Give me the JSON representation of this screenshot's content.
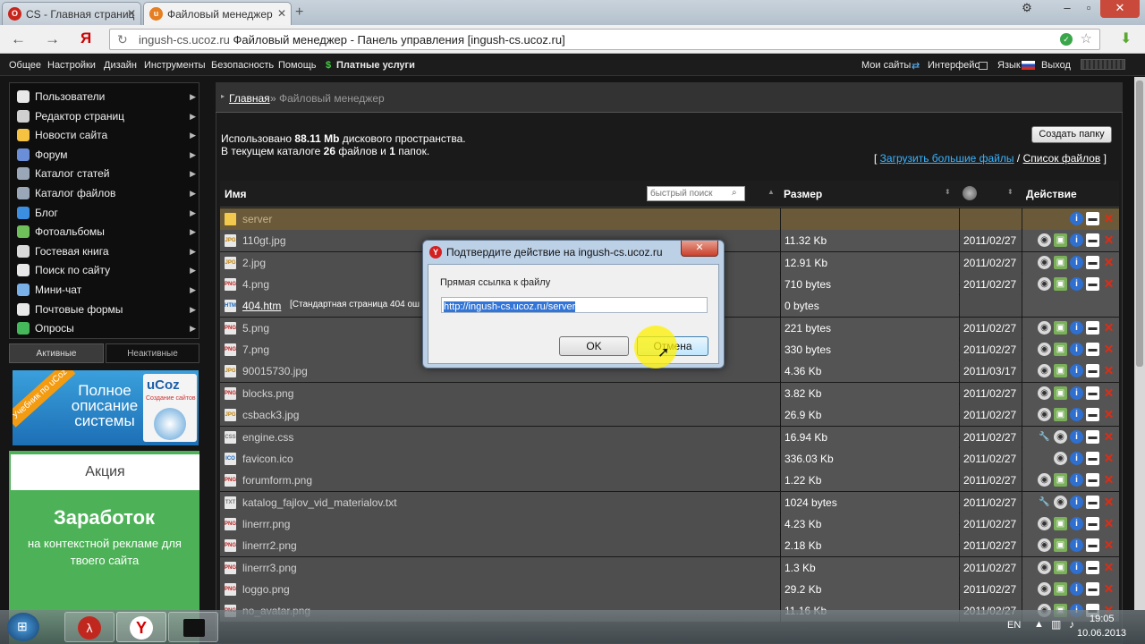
{
  "browser": {
    "tabs": [
      {
        "label": "CS - Главная страниц",
        "icon": "opera-icon",
        "active": false
      },
      {
        "label": "Файловый менеджер",
        "icon": "ucoz-icon",
        "active": true
      }
    ],
    "url_host": "ingush-cs.ucoz.ru",
    "url_title": "Файловый менеджер - Панель управления [ingush-cs.ucoz.ru]",
    "yandex_label": "Я"
  },
  "topmenu": {
    "left": [
      "Общее",
      "Настройки",
      "Дизайн",
      "Инструменты",
      "Безопасность",
      "Помощь",
      "Платные услуги"
    ],
    "right": [
      "Мои сайты",
      "Интерфейс",
      "Язык",
      "Выход"
    ]
  },
  "sidebar": {
    "items": [
      "Пользователи",
      "Редактор страниц",
      "Новости сайта",
      "Форум",
      "Каталог статей",
      "Каталог файлов",
      "Блог",
      "Фотоальбомы",
      "Гостевая книга",
      "Поиск по сайту",
      "Мини-чат",
      "Почтовые формы",
      "Опросы"
    ],
    "tab_active": "Активные",
    "tab_inactive": "Неактивные",
    "banner_ribbon": "Учебник по uCoz",
    "banner_text": "Полное описание системы",
    "banner_logo": "uCoz",
    "banner_sub": "Создание сайтов",
    "promo_title": "Акция",
    "promo_heading": "Заработок",
    "promo_text": "на контекстной рекламе для твоего сайта"
  },
  "breadcrumb": {
    "home": "Главная",
    "sep": "»",
    "current": "Файловый менеджер"
  },
  "info": {
    "used_prefix": "Использовано",
    "used_value": "88.11 Mb",
    "used_suffix": "дискового пространства.",
    "count_prefix": "В текущем каталоге",
    "files": "26",
    "files_word": "файлов и",
    "folders": "1",
    "folders_word": "папок.",
    "create_folder": "Создать папку",
    "upload_big": "Загрузить большие файлы",
    "file_list": "Список файлов"
  },
  "table": {
    "col_name": "Имя",
    "search_placeholder": "быстрый поиск",
    "col_size": "Размер",
    "col_action": "Действие",
    "rows": [
      {
        "name": "server",
        "type": "folder",
        "size": "",
        "date": "",
        "actions": [
          "info",
          "move",
          "delete"
        ]
      },
      {
        "name": "110gt.jpg",
        "type": "JPG",
        "size": "11.32 Kb",
        "date": "2011/02/27",
        "actions": [
          "view",
          "image",
          "info",
          "move",
          "delete"
        ]
      },
      {
        "name": "2.jpg",
        "type": "JPG",
        "size": "12.91 Kb",
        "date": "2011/02/27",
        "actions": [
          "view",
          "image",
          "info",
          "move",
          "delete"
        ]
      },
      {
        "name": "4.png",
        "type": "PNG",
        "size": "710 bytes",
        "date": "2011/02/27",
        "actions": [
          "view",
          "image",
          "info",
          "move",
          "delete"
        ]
      },
      {
        "name": "404.htm",
        "note": "[Стандартная страница 404 ош",
        "type": "HTM",
        "size": "0 bytes",
        "date": "",
        "actions": []
      },
      {
        "name": "5.png",
        "type": "PNG",
        "size": "221 bytes",
        "date": "2011/02/27",
        "actions": [
          "view",
          "image",
          "info",
          "move",
          "delete"
        ]
      },
      {
        "name": "7.png",
        "type": "PNG",
        "size": "330 bytes",
        "date": "2011/02/27",
        "actions": [
          "view",
          "image",
          "info",
          "move",
          "delete"
        ]
      },
      {
        "name": "90015730.jpg",
        "type": "JPG",
        "size": "4.36 Kb",
        "date": "2011/03/17",
        "actions": [
          "view",
          "image",
          "info",
          "move",
          "delete"
        ]
      },
      {
        "name": "blocks.png",
        "type": "PNG",
        "size": "3.82 Kb",
        "date": "2011/02/27",
        "actions": [
          "view",
          "image",
          "info",
          "move",
          "delete"
        ]
      },
      {
        "name": "csback3.jpg",
        "type": "JPG",
        "size": "26.9 Kb",
        "date": "2011/02/27",
        "actions": [
          "view",
          "image",
          "info",
          "move",
          "delete"
        ]
      },
      {
        "name": "engine.css",
        "type": "CSS",
        "size": "16.94 Kb",
        "date": "2011/02/27",
        "actions": [
          "edit",
          "view",
          "info",
          "move",
          "delete"
        ]
      },
      {
        "name": "favicon.ico",
        "type": "ICO",
        "size": "336.03 Kb",
        "date": "2011/02/27",
        "actions": [
          "view",
          "info",
          "move",
          "delete"
        ]
      },
      {
        "name": "forumform.png",
        "type": "PNG",
        "size": "1.22 Kb",
        "date": "2011/02/27",
        "actions": [
          "view",
          "image",
          "info",
          "move",
          "delete"
        ]
      },
      {
        "name": "katalog_fajlov_vid_materialov.txt",
        "type": "TXT",
        "size": "1024 bytes",
        "date": "2011/02/27",
        "actions": [
          "edit",
          "view",
          "info",
          "move",
          "delete"
        ]
      },
      {
        "name": "linerrr.png",
        "type": "PNG",
        "size": "4.23 Kb",
        "date": "2011/02/27",
        "actions": [
          "view",
          "image",
          "info",
          "move",
          "delete"
        ]
      },
      {
        "name": "linerrr2.png",
        "type": "PNG",
        "size": "2.18 Kb",
        "date": "2011/02/27",
        "actions": [
          "view",
          "image",
          "info",
          "move",
          "delete"
        ]
      },
      {
        "name": "linerrr3.png",
        "type": "PNG",
        "size": "1.3 Kb",
        "date": "2011/02/27",
        "actions": [
          "view",
          "image",
          "info",
          "move",
          "delete"
        ]
      },
      {
        "name": "loggo.png",
        "type": "PNG",
        "size": "29.2 Kb",
        "date": "2011/02/27",
        "actions": [
          "view",
          "image",
          "info",
          "move",
          "delete"
        ]
      },
      {
        "name": "no_avatar.png",
        "type": "PNG",
        "size": "11.16 Kb",
        "date": "2011/02/27",
        "actions": [
          "view",
          "image",
          "info",
          "move",
          "delete"
        ]
      }
    ]
  },
  "dialog": {
    "title": "Подтвердите действие на ingush-cs.ucoz.ru",
    "label": "Прямая ссылка к файлу",
    "value": "http://ingush-cs.ucoz.ru/server",
    "ok": "OK",
    "cancel": "Отмена"
  },
  "taskbar": {
    "lang": "EN",
    "time": "19:05",
    "date": "10.06.2013"
  }
}
